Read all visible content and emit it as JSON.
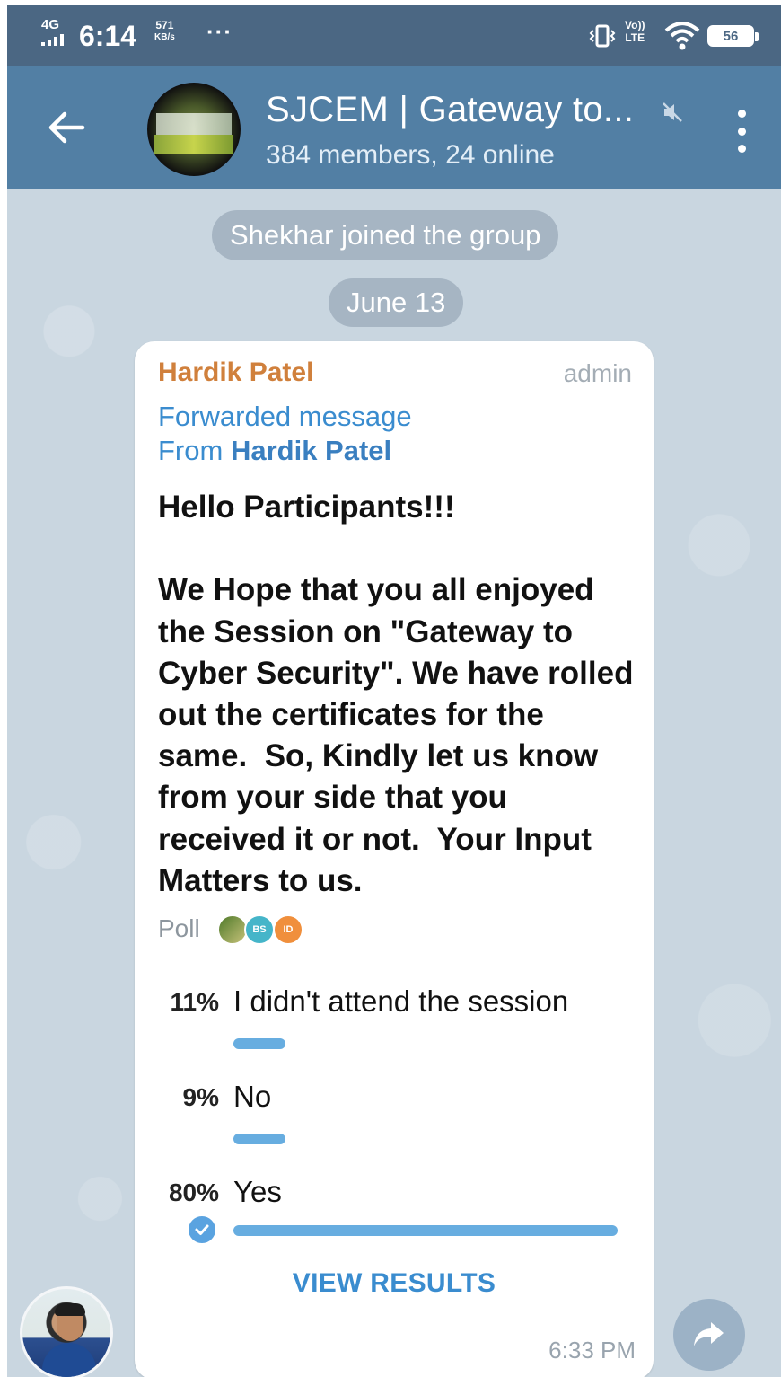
{
  "status_bar": {
    "network": "4G",
    "time": "6:14",
    "speed_value": "571",
    "speed_unit": "KB/s",
    "more_indicator": "···",
    "volte_top": "Vo))",
    "volte_bottom": "LTE",
    "battery": "56"
  },
  "header": {
    "title": "SJCEM | Gateway to...",
    "subtitle": "384 members, 24 online",
    "muted": true
  },
  "chat": {
    "service_message": "Shekhar joined the group",
    "date_separator": "June 13"
  },
  "message": {
    "sender": "Hardik Patel",
    "role_tag": "admin",
    "forward_label": "Forwarded message",
    "forward_from_prefix": "From",
    "forward_from_name": "Hardik Patel",
    "text": "Hello Participants!!!\n\nWe Hope that you all enjoyed the Session on \"Gateway to Cyber Security\". We have rolled out the certificates for the same.  So, Kindly let us know from your side that you received it or not.  Your Input Matters to us.",
    "poll": {
      "label": "Poll",
      "voters": [
        {
          "initials": "",
          "color": "#6a8a3a"
        },
        {
          "initials": "BS",
          "color": "#45b5c9"
        },
        {
          "initials": "ID",
          "color": "#f08f3c"
        }
      ],
      "options": [
        {
          "percent": "11%",
          "text": "I didn't attend the session",
          "fraction": 0.11,
          "chosen": false
        },
        {
          "percent": "9%",
          "text": "No",
          "fraction": 0.09,
          "chosen": false
        },
        {
          "percent": "80%",
          "text": "Yes",
          "fraction": 0.8,
          "chosen": true
        }
      ],
      "action_label": "VIEW RESULTS"
    },
    "time": "6:33 PM"
  },
  "colors": {
    "status_bar": "#4b6783",
    "app_bar": "#527fa4",
    "chat_background": "#c9d6e0",
    "accent": "#3a8ccf",
    "sender_name": "#d0803c",
    "poll_bar": "#67ade0"
  },
  "icons": {
    "back": "arrow-left-icon",
    "mute": "mute-icon",
    "menu": "more-vertical-icon",
    "check": "check-circle-icon",
    "share": "share-icon"
  }
}
